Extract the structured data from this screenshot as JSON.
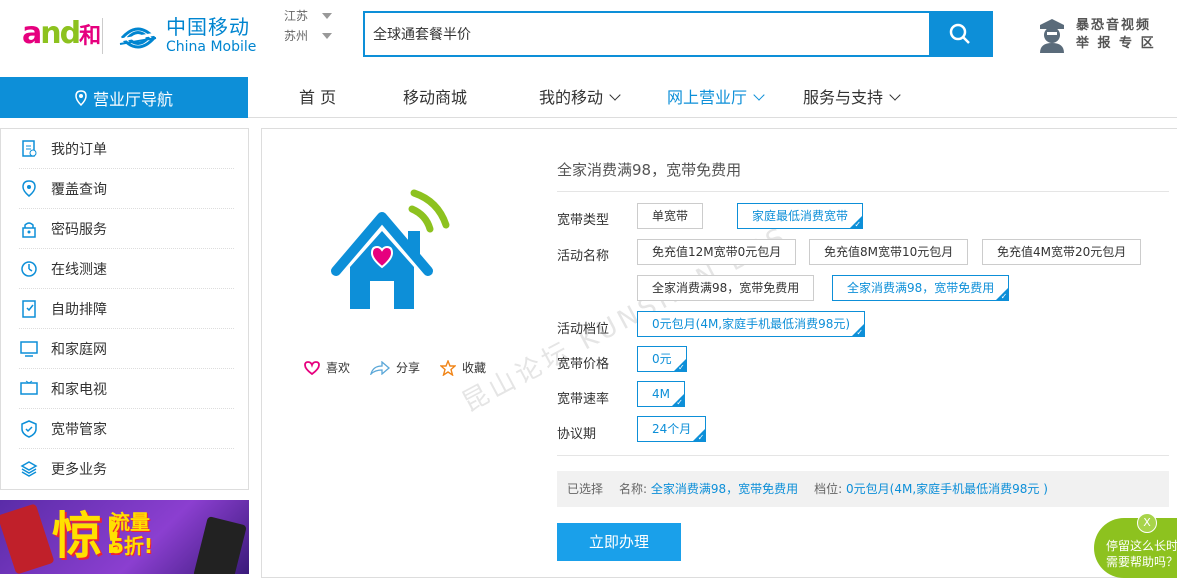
{
  "header": {
    "logo_and": {
      "a": "a",
      "n": "nd",
      "he": "和"
    },
    "brand_cn": "中国移动",
    "brand_en": "China Mobile",
    "province": "江苏",
    "city": "苏州",
    "search_value": "全球通套餐半价",
    "report_line1": "暴恐音视频",
    "report_line2": "举 报 专 区"
  },
  "nav": {
    "guide_label": "营业厅导航",
    "items": [
      {
        "label": "首 页"
      },
      {
        "label": "移动商城"
      },
      {
        "label": "我的移动"
      },
      {
        "label": "网上营业厅"
      },
      {
        "label": "服务与支持"
      }
    ]
  },
  "sidebar": {
    "items": [
      {
        "label": "我的订单",
        "icon": "order-icon"
      },
      {
        "label": "覆盖查询",
        "icon": "location-icon"
      },
      {
        "label": "密码服务",
        "icon": "lock-icon"
      },
      {
        "label": "在线测速",
        "icon": "speed-icon"
      },
      {
        "label": "自助排障",
        "icon": "repair-icon"
      },
      {
        "label": "和家庭网",
        "icon": "monitor-icon"
      },
      {
        "label": "和家电视",
        "icon": "tv-icon"
      },
      {
        "label": "宽带管家",
        "icon": "shield-icon"
      },
      {
        "label": "更多业务",
        "icon": "layers-icon"
      }
    ],
    "banner_big": "惊!",
    "banner_small_1": "流量",
    "banner_small_2": "5折!"
  },
  "product": {
    "title": "全家消费满98，宽带免费用",
    "actions": {
      "like": "喜欢",
      "share": "分享",
      "favorite": "收藏"
    },
    "watermark": "昆山论坛 KUNSHAN BBS",
    "rows": {
      "type_label": "宽带类型",
      "type_options": [
        "单宽带",
        "家庭最低消费宽带"
      ],
      "activity_label": "活动名称",
      "activity_options": [
        "免充值12M宽带0元包月",
        "免充值8M宽带10元包月",
        "免充值4M宽带20元包月",
        "全家消费满98，宽带免费用",
        "全家消费满98，宽带免费用"
      ],
      "tier_label": "活动档位",
      "tier_option": "0元包月(4M,家庭手机最低消费98元)",
      "price_label": "宽带价格",
      "price_option": "0元",
      "speed_label": "宽带速率",
      "speed_option": "4M",
      "term_label": "协议期",
      "term_option": "24个月"
    },
    "summary": {
      "selected": "已选择",
      "name_label": "名称:",
      "name_value": "全家消费满98，宽带免费用",
      "tier_label": "档位:",
      "tier_value": "0元包月(4M,家庭手机最低消费98元 )"
    },
    "submit_label": "立即办理"
  },
  "help": {
    "line1": "停留这么长时",
    "line2": "需要帮助吗？",
    "close": "X"
  },
  "colors": {
    "brand_blue": "#0d8fd8",
    "and_pink": "#e6007e",
    "and_green": "#8dc21f"
  }
}
